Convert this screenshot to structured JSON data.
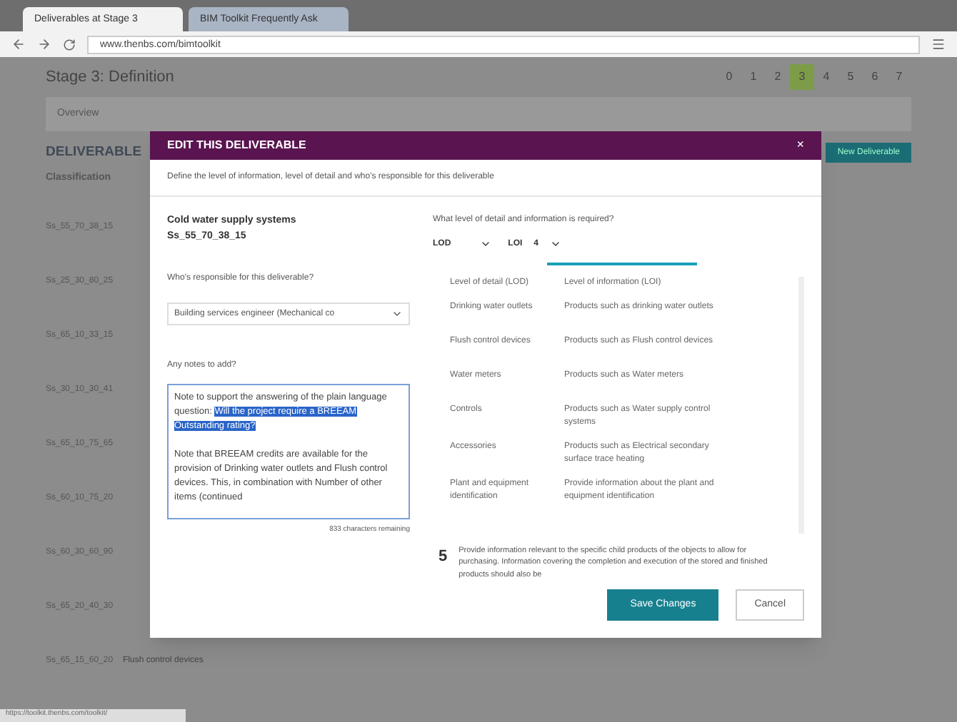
{
  "browser": {
    "tabs": [
      {
        "label": "Deliverables at Stage 3",
        "selected": true
      },
      {
        "label": "BIM Toolkit Frequently Ask",
        "selected": false
      }
    ],
    "url": "www.thenbs.com/bimtoolkit"
  },
  "page": {
    "stage_title": "Stage 3: Definition",
    "stages": [
      {
        "label": "0",
        "selected": false
      },
      {
        "label": "1",
        "selected": false
      },
      {
        "label": "2",
        "selected": false
      },
      {
        "label": "3",
        "selected": true
      },
      {
        "label": "4",
        "selected": false
      },
      {
        "label": "5",
        "selected": false
      },
      {
        "label": "6",
        "selected": false
      },
      {
        "label": "7",
        "selected": false
      }
    ],
    "toolbar": [
      "Overview"
    ],
    "heading": "DELIVERABLE",
    "add_button": "New Deliverable",
    "table": {
      "columns": [
        "Classification"
      ],
      "rows": [
        {
          "code": "Ss_55_70_38_15"
        },
        {
          "code": "Ss_25_30_80_25"
        },
        {
          "code": "Ss_65_10_33_15"
        },
        {
          "code": "Ss_30_10_30_41"
        },
        {
          "code": "Ss_65_10_75_65"
        },
        {
          "code": "Ss_60_10_75_20"
        },
        {
          "code": "Ss_60_30_60_90"
        },
        {
          "code": "Ss_65_20_40_30"
        },
        {
          "code": "Ss_65_15_60_20",
          "name": "Flush control devices"
        }
      ]
    }
  },
  "dialog": {
    "title": "EDIT THIS DELIVERABLE",
    "close": "×",
    "intro": "Define the level of information, level of detail and who's responsible for this deliverable",
    "item_name": "Cold water supply systems",
    "item_code": "Ss_55_70_38_15",
    "responsible_label": "Who's responsible for this deliverable?",
    "responsible_value": "Building services engineer (Mechanical co",
    "notes_label": "Any notes to add?",
    "notes": [
      {
        "text": "Note to support the answering of the plain language question: ",
        "selected": false
      },
      {
        "text": "Will the project require a BREEAM Outstanding rating?",
        "selected": true
      },
      {
        "text": "Note that BREEAM credits are available for the provision of Drinking water outlets and Flush control devices. This, in combination with Number of other items (continued",
        "selected": false
      }
    ],
    "chars_left": "833 characters remaining",
    "level_label": "What level of detail and information is required?",
    "lod": "LOD",
    "loi": "LOI",
    "loi_value": "4",
    "level_columns": [
      "Level of detail (LOD)",
      "Level of information (LOI)"
    ],
    "level_rows": [
      [
        "Drinking water outlets",
        "Products such as drinking water outlets"
      ],
      [
        "Flush control devices",
        "Products such as Flush control devices"
      ],
      [
        "Water meters",
        "Products such as Water meters"
      ],
      [
        "Controls",
        "Products such as Water supply control systems"
      ],
      [
        "Accessories",
        "Products such as Electrical secondary surface trace heating"
      ],
      [
        "Plant and equipment identification",
        "Provide information about the plant and equipment identification"
      ]
    ],
    "next_level": "5",
    "next_level_text": "Provide information relevant to the specific child products of the objects to allow for purchasing. Information covering the completion and execution of the stored and finished products should also be",
    "save": "Save Changes",
    "cancel": "Cancel"
  },
  "status_url": "https://toolkit.thenbs.com/toolkit/"
}
